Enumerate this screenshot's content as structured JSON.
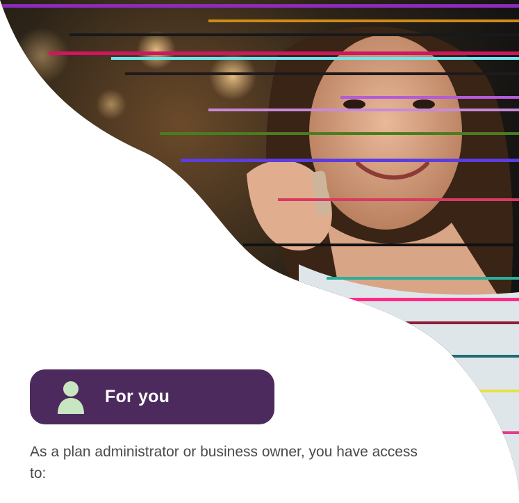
{
  "hero": {
    "image_description_icon": "woman-on-phone-photo",
    "accent_color": "#4d2a5e",
    "curve_fill": "#ffffff"
  },
  "section": {
    "badge_label": "For you",
    "badge_icon": "person-icon",
    "badge_bg": "#4d2a5e",
    "badge_icon_color": "#c9e6c2",
    "intro_text": "As a plan administrator or business owner, you have access to:"
  }
}
